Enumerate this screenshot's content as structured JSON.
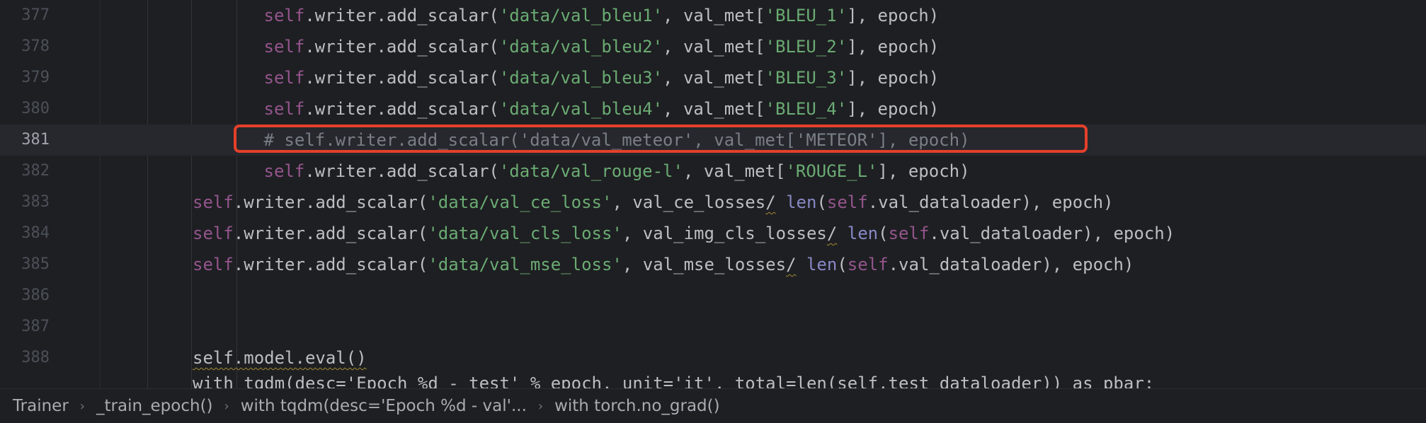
{
  "editor": {
    "lines": [
      {
        "number": "377",
        "indent": "        ",
        "tokens": [
          {
            "t": "self",
            "c": "self"
          },
          {
            "t": ".writer.add_scalar(",
            "c": ""
          },
          {
            "t": "'data/val_bleu1'",
            "c": "str"
          },
          {
            "t": ", val_met[",
            "c": ""
          },
          {
            "t": "'BLEU_1'",
            "c": "str"
          },
          {
            "t": "], epoch)",
            "c": ""
          }
        ]
      },
      {
        "number": "378",
        "indent": "        ",
        "tokens": [
          {
            "t": "self",
            "c": "self"
          },
          {
            "t": ".writer.add_scalar(",
            "c": ""
          },
          {
            "t": "'data/val_bleu2'",
            "c": "str"
          },
          {
            "t": ", val_met[",
            "c": ""
          },
          {
            "t": "'BLEU_2'",
            "c": "str"
          },
          {
            "t": "], epoch)",
            "c": ""
          }
        ]
      },
      {
        "number": "379",
        "indent": "        ",
        "tokens": [
          {
            "t": "self",
            "c": "self"
          },
          {
            "t": ".writer.add_scalar(",
            "c": ""
          },
          {
            "t": "'data/val_bleu3'",
            "c": "str"
          },
          {
            "t": ", val_met[",
            "c": ""
          },
          {
            "t": "'BLEU_3'",
            "c": "str"
          },
          {
            "t": "], epoch)",
            "c": ""
          }
        ]
      },
      {
        "number": "380",
        "indent": "        ",
        "tokens": [
          {
            "t": "self",
            "c": "self"
          },
          {
            "t": ".writer.add_scalar(",
            "c": ""
          },
          {
            "t": "'data/val_bleu4'",
            "c": "str"
          },
          {
            "t": ", val_met[",
            "c": ""
          },
          {
            "t": "'BLEU_4'",
            "c": "str"
          },
          {
            "t": "], epoch)",
            "c": ""
          }
        ]
      },
      {
        "number": "381",
        "indent": "        ",
        "current": true,
        "tokens": [
          {
            "t": "# self.writer.add_scalar('data/val_meteor', val_met['METEOR'], epoch)",
            "c": "cmt"
          }
        ]
      },
      {
        "number": "382",
        "indent": "        ",
        "tokens": [
          {
            "t": "self",
            "c": "self"
          },
          {
            "t": ".writer.add_scalar(",
            "c": ""
          },
          {
            "t": "'data/val_rouge-l'",
            "c": "str"
          },
          {
            "t": ", val_met[",
            "c": ""
          },
          {
            "t": "'ROUGE_L'",
            "c": "str"
          },
          {
            "t": "], epoch)",
            "c": ""
          }
        ]
      },
      {
        "number": "383",
        "indent": "",
        "tokens": [
          {
            "t": "self",
            "c": "self"
          },
          {
            "t": ".writer.add_scalar(",
            "c": ""
          },
          {
            "t": "'data/val_ce_loss'",
            "c": "str"
          },
          {
            "t": ", val_ce_losses",
            "c": ""
          },
          {
            "t": "/",
            "c": "warn"
          },
          {
            "t": " ",
            "c": ""
          },
          {
            "t": "len",
            "c": "bi"
          },
          {
            "t": "(",
            "c": ""
          },
          {
            "t": "self",
            "c": "self"
          },
          {
            "t": ".val_dataloader), epoch)",
            "c": ""
          }
        ]
      },
      {
        "number": "384",
        "indent": "",
        "tokens": [
          {
            "t": "self",
            "c": "self"
          },
          {
            "t": ".writer.add_scalar(",
            "c": ""
          },
          {
            "t": "'data/val_cls_loss'",
            "c": "str"
          },
          {
            "t": ", val_img_cls_losses",
            "c": ""
          },
          {
            "t": "/",
            "c": "warn"
          },
          {
            "t": " ",
            "c": ""
          },
          {
            "t": "len",
            "c": "bi"
          },
          {
            "t": "(",
            "c": ""
          },
          {
            "t": "self",
            "c": "self"
          },
          {
            "t": ".val_dataloader), epoch)",
            "c": ""
          }
        ]
      },
      {
        "number": "385",
        "indent": "",
        "tokens": [
          {
            "t": "self",
            "c": "self"
          },
          {
            "t": ".writer.add_scalar(",
            "c": ""
          },
          {
            "t": "'data/val_mse_loss'",
            "c": "str"
          },
          {
            "t": ", val_mse_losses",
            "c": ""
          },
          {
            "t": "/",
            "c": "warn"
          },
          {
            "t": " ",
            "c": ""
          },
          {
            "t": "len",
            "c": "bi"
          },
          {
            "t": "(",
            "c": ""
          },
          {
            "t": "self",
            "c": "self"
          },
          {
            "t": ".val_dataloader), epoch)",
            "c": ""
          }
        ]
      },
      {
        "number": "386",
        "indent": "",
        "tokens": []
      },
      {
        "number": "387",
        "indent": "",
        "tokens": []
      },
      {
        "number": "388",
        "indent": "",
        "tokens": [
          {
            "t": "self.model.eval()",
            "c": "warn"
          }
        ]
      }
    ],
    "partial_line": "with tqdm(desc='Epoch %d - test' % epoch, unit='it', total=len(self.test_dataloader)) as pbar:"
  },
  "breadcrumbs": [
    "Trainer",
    "_train_epoch()",
    "with tqdm(desc='Epoch %d - val'...",
    "with torch.no_grad()"
  ],
  "colors": {
    "highlight_box": "#e4402a",
    "background": "#1e1f22"
  }
}
